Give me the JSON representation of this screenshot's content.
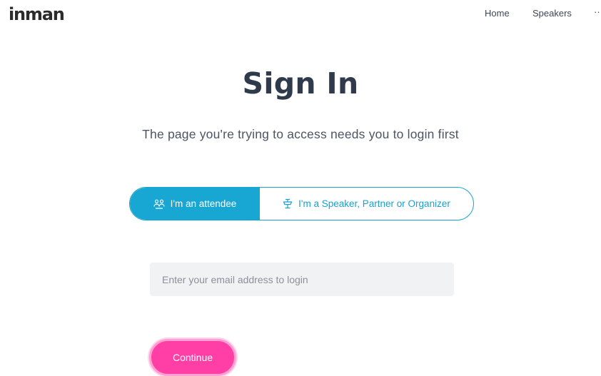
{
  "header": {
    "logo": "inman",
    "nav": [
      {
        "label": "Home"
      },
      {
        "label": "Speakers"
      },
      {
        "label": "···"
      }
    ]
  },
  "main": {
    "title": "Sign In",
    "subtitle": "The page you're trying to access needs you to login first",
    "toggle": {
      "options": [
        {
          "label": "I'm an attendee",
          "icon": "people-icon",
          "selected": true
        },
        {
          "label": "I'm a Speaker, Partner or Organizer",
          "icon": "podium-icon",
          "selected": false
        }
      ]
    },
    "email": {
      "value": "",
      "placeholder": "Enter your email address to login"
    },
    "continue_label": "Continue"
  },
  "colors": {
    "accent": "#18a6d3",
    "button": "#ff3fa6",
    "title": "#2f3b4c"
  }
}
